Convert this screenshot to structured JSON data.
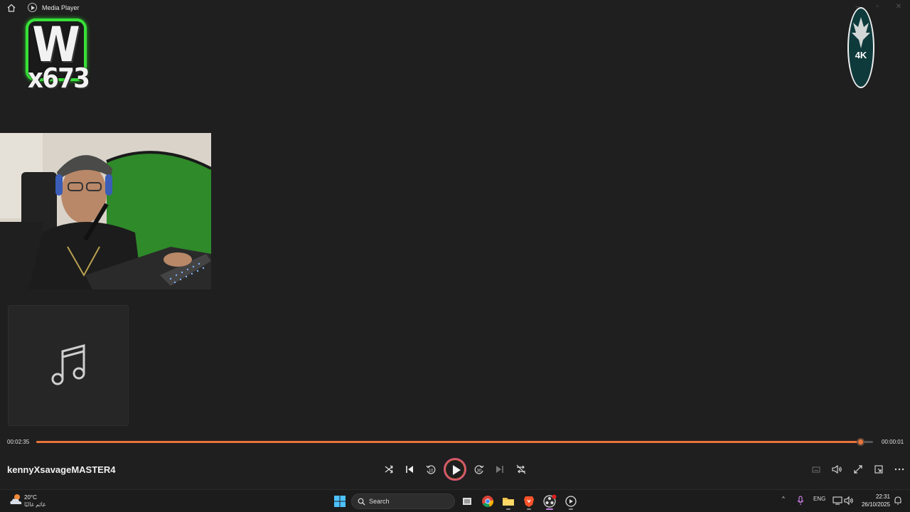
{
  "titlebar": {
    "app_title": "Media Player"
  },
  "overlay": {
    "logo_w_letter": "W",
    "logo_w_sub": "x673",
    "logo_4k": "4K"
  },
  "player": {
    "elapsed": "00:02:35",
    "remaining": "00:00:01",
    "progress": 0.985,
    "track_title": "kennyXsavageMASTER4",
    "skip_back_seconds": "10",
    "skip_forward_seconds": "30",
    "accent_color": "#e8743b"
  },
  "taskbar": {
    "weather_temp": "20°C",
    "weather_desc": "غائم غالبًا",
    "search_placeholder": "Search",
    "language": "ENG",
    "time": "22:31",
    "date": "26/10/2025",
    "apps": [
      "task-view",
      "chrome",
      "file-explorer",
      "brave",
      "obs",
      "media-player"
    ]
  }
}
